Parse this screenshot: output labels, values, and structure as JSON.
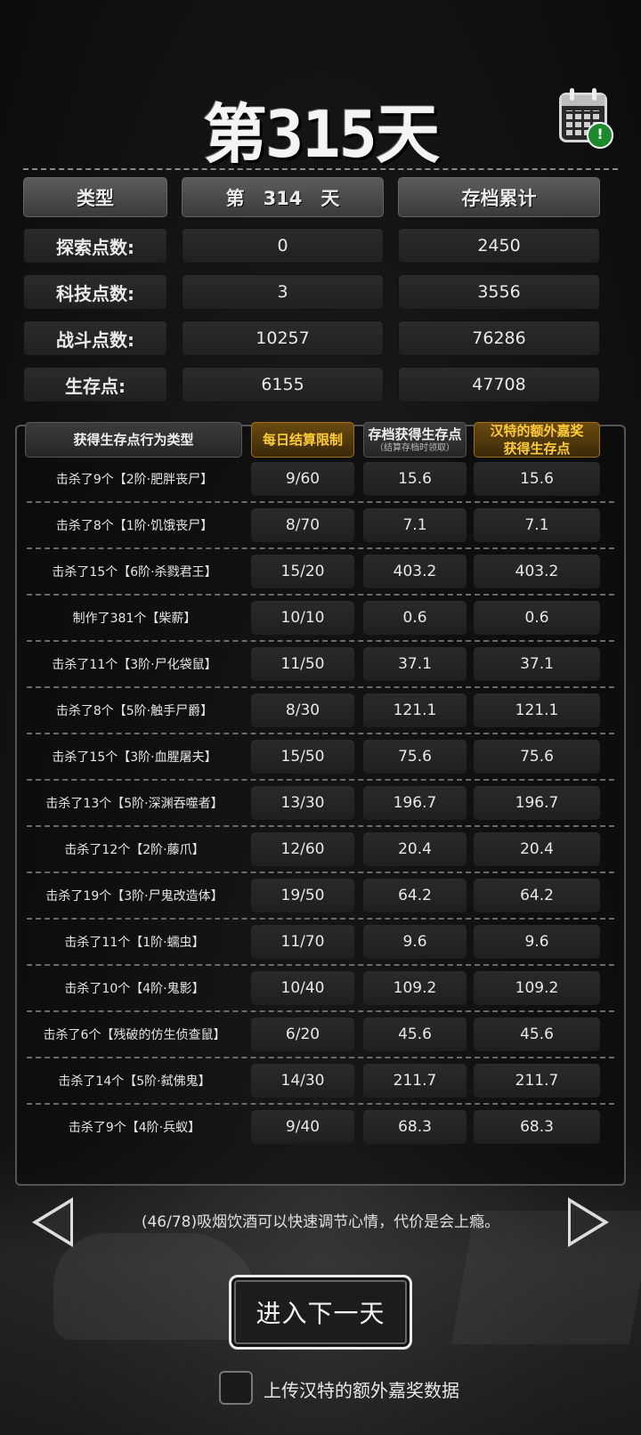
{
  "day_title": "第315天",
  "summary": {
    "headers": [
      "类型",
      "第　314　天",
      "存档累计"
    ],
    "rows": [
      {
        "label": "探索点数:",
        "day": "0",
        "total": "2450"
      },
      {
        "label": "科技点数:",
        "day": "3",
        "total": "3556"
      },
      {
        "label": "战斗点数:",
        "day": "10257",
        "total": "76286"
      },
      {
        "label": "生存点:",
        "day": "6155",
        "total": "47708"
      }
    ]
  },
  "detail": {
    "col1": "获得生存点行为类型",
    "col2": "每日结算限制",
    "col3": "存档获得生存点",
    "col3_sub": "（结算存档时领取）",
    "col4_line1": "汉特的额外嘉奖",
    "col4_line2": "获得生存点",
    "rows": [
      {
        "action": "击杀了9个【2阶·肥胖丧尸】",
        "limit": "9/60",
        "save": "15.6",
        "bonus": "15.6"
      },
      {
        "action": "击杀了8个【1阶·饥饿丧尸】",
        "limit": "8/70",
        "save": "7.1",
        "bonus": "7.1"
      },
      {
        "action": "击杀了15个【6阶·杀戮君王】",
        "limit": "15/20",
        "save": "403.2",
        "bonus": "403.2"
      },
      {
        "action": "制作了381个【柴薪】",
        "limit": "10/10",
        "save": "0.6",
        "bonus": "0.6"
      },
      {
        "action": "击杀了11个【3阶·尸化袋鼠】",
        "limit": "11/50",
        "save": "37.1",
        "bonus": "37.1"
      },
      {
        "action": "击杀了8个【5阶·触手尸爵】",
        "limit": "8/30",
        "save": "121.1",
        "bonus": "121.1"
      },
      {
        "action": "击杀了15个【3阶·血腥屠夫】",
        "limit": "15/50",
        "save": "75.6",
        "bonus": "75.6"
      },
      {
        "action": "击杀了13个【5阶·深渊吞噬者】",
        "limit": "13/30",
        "save": "196.7",
        "bonus": "196.7"
      },
      {
        "action": "击杀了12个【2阶·藤爪】",
        "limit": "12/60",
        "save": "20.4",
        "bonus": "20.4"
      },
      {
        "action": "击杀了19个【3阶·尸鬼改造体】",
        "limit": "19/50",
        "save": "64.2",
        "bonus": "64.2"
      },
      {
        "action": "击杀了11个【1阶·蠕虫】",
        "limit": "11/70",
        "save": "9.6",
        "bonus": "9.6"
      },
      {
        "action": "击杀了10个【4阶·鬼影】",
        "limit": "10/40",
        "save": "109.2",
        "bonus": "109.2"
      },
      {
        "action": "击杀了6个【残破的仿生侦查鼠】",
        "limit": "6/20",
        "save": "45.6",
        "bonus": "45.6"
      },
      {
        "action": "击杀了14个【5阶·弑佛鬼】",
        "limit": "14/30",
        "save": "211.7",
        "bonus": "211.7"
      },
      {
        "action": "击杀了9个【4阶·兵蚁】",
        "limit": "9/40",
        "save": "68.3",
        "bonus": "68.3"
      }
    ]
  },
  "tip": "(46/78)吸烟饮酒可以快速调节心情，代价是会上瘾。",
  "next_day_label": "进入下一天",
  "upload_label": "上传汉特的额外嘉奖数据",
  "upload_checked": false,
  "colors": {
    "accent_gold": "#ffcc33",
    "alert_green": "#1a8a2a"
  },
  "icons": {
    "calendar": "calendar-alert-icon",
    "prev": "arrow-left-icon",
    "next": "arrow-right-icon"
  }
}
